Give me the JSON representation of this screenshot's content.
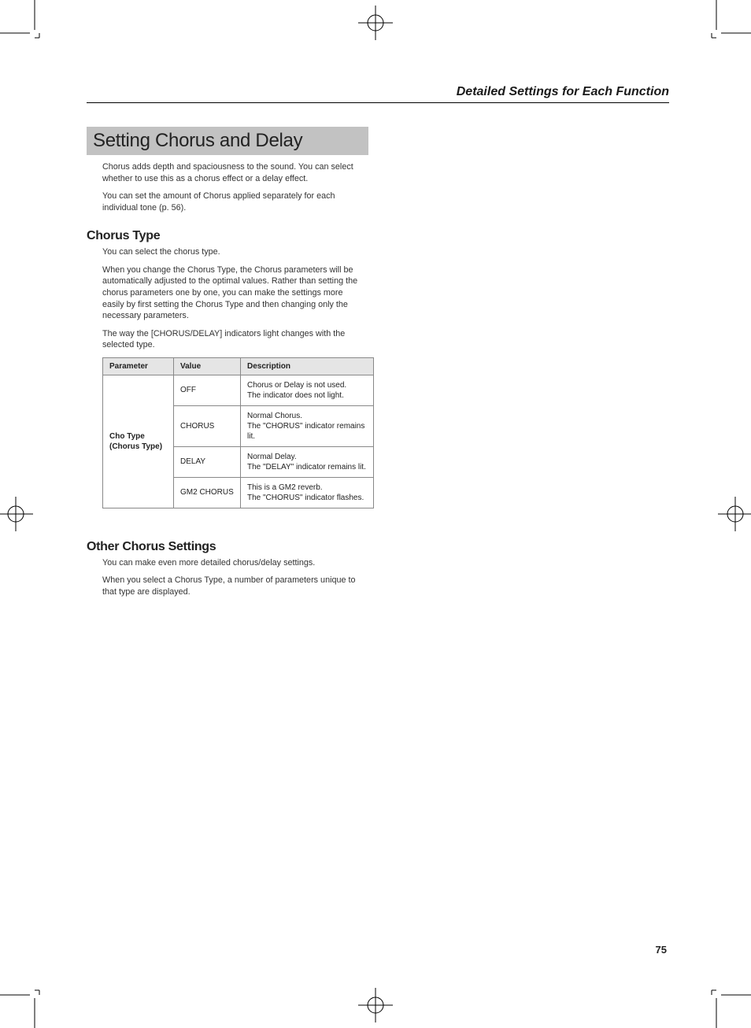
{
  "header": {
    "title": "Detailed Settings for Each Function"
  },
  "section1": {
    "heading": "Setting Chorus and Delay",
    "p1": "Chorus adds depth and spaciousness to the sound. You can select whether to use this as a chorus effect or a delay effect.",
    "p2": "You can set the amount of Chorus applied separately for each individual tone (p. 56)."
  },
  "chorus_type": {
    "heading": "Chorus Type",
    "p1": "You can select the chorus type.",
    "p2": "When you change the Chorus Type, the Chorus parameters will be automatically adjusted to the optimal values. Rather than setting the chorus parameters one by one, you can make the settings more easily by first setting the Chorus Type and then changing only the necessary parameters.",
    "p3": "The way the [CHORUS/DELAY] indicators light changes with the selected type."
  },
  "table": {
    "headers": {
      "parameter": "Parameter",
      "value": "Value",
      "description": "Description"
    },
    "param_name": "Cho Type\n(Chorus Type)",
    "rows": [
      {
        "value": "OFF",
        "desc": "Chorus or Delay is not used.\nThe indicator does not light."
      },
      {
        "value": "CHORUS",
        "desc": "Normal Chorus.\nThe \"CHORUS\" indicator remains lit."
      },
      {
        "value": "DELAY",
        "desc": "Normal Delay.\nThe \"DELAY\" indicator remains lit."
      },
      {
        "value": "GM2 CHORUS",
        "desc": "This is a GM2 reverb.\nThe \"CHORUS\" indicator flashes."
      }
    ]
  },
  "other_settings": {
    "heading": "Other Chorus Settings",
    "p1": "You can make even more detailed chorus/delay settings.",
    "p2": "When you select a Chorus Type, a number of parameters unique to that type are displayed."
  },
  "page_number": "75"
}
